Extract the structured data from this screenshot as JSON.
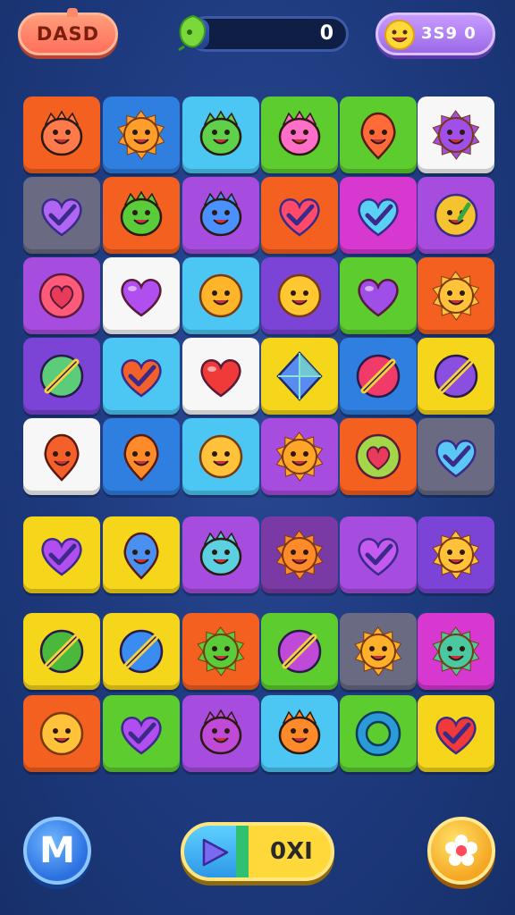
{
  "header": {
    "level_label": "DASD",
    "progress_value": "0",
    "progress_fraction": 0.0,
    "score_value": "3S9 0"
  },
  "footer": {
    "menu_label": "M",
    "play_label": "0XI"
  },
  "colors": {
    "orange": "#f4601f",
    "blue": "#2f7fe0",
    "cyan": "#4cc6f2",
    "green": "#5ccc2e",
    "white": "#f7f7f7",
    "gray": "#6a6a82",
    "purple": "#a64ddf",
    "violet": "#7b43d6",
    "magenta": "#d638d0",
    "yellow": "#f6d61a",
    "dark_purple": "#7a3aa6"
  },
  "board": {
    "rows": [
      [
        {
          "bg": "orange",
          "icon": "monster-icon",
          "ic": "#ff7a4a"
        },
        {
          "bg": "blue",
          "icon": "sun-icon",
          "ic": "#ff9e2a"
        },
        {
          "bg": "cyan",
          "icon": "monster-icon",
          "ic": "#5fd04a"
        },
        {
          "bg": "green",
          "icon": "monster-icon",
          "ic": "#ff6fc8"
        },
        {
          "bg": "green",
          "icon": "drop-face-icon",
          "ic": "#ff6a3a"
        },
        {
          "bg": "white",
          "icon": "sun-icon",
          "ic": "#a050e8"
        }
      ],
      [
        {
          "bg": "gray",
          "icon": "heart-check-icon",
          "ic": "#b066f2"
        },
        {
          "bg": "orange",
          "icon": "monster-icon",
          "ic": "#5acc3a"
        },
        {
          "bg": "purple",
          "icon": "monster-icon",
          "ic": "#4a90ff"
        },
        {
          "bg": "orange",
          "icon": "heart-check-icon",
          "ic": "#ff4a6a"
        },
        {
          "bg": "magenta",
          "icon": "heart-check-icon",
          "ic": "#5ad0f5"
        },
        {
          "bg": "purple",
          "icon": "face-check-icon",
          "ic": "#f5c330"
        }
      ],
      [
        {
          "bg": "purple",
          "icon": "heart-ring-icon",
          "ic": "#ff5a7a"
        },
        {
          "bg": "white",
          "icon": "heart-icon",
          "ic": "#b04ef0"
        },
        {
          "bg": "cyan",
          "icon": "smiley-icon",
          "ic": "#ffb52a"
        },
        {
          "bg": "violet",
          "icon": "smiley-icon",
          "ic": "#ffc830"
        },
        {
          "bg": "green",
          "icon": "heart-icon",
          "ic": "#a04ee8"
        },
        {
          "bg": "orange",
          "icon": "sun-icon",
          "ic": "#ffc23a"
        }
      ],
      [
        {
          "bg": "violet",
          "icon": "slash-ball-icon",
          "ic": "#5acc7a"
        },
        {
          "bg": "cyan",
          "icon": "heart-check-icon",
          "ic": "#f4602a"
        },
        {
          "bg": "white",
          "icon": "heart-icon",
          "ic": "#f03a3a"
        },
        {
          "bg": "yellow",
          "icon": "gem-icon",
          "ic": "#5a8cf0"
        },
        {
          "bg": "blue",
          "icon": "slash-ball-icon",
          "ic": "#f03a6a"
        },
        {
          "bg": "yellow",
          "icon": "slash-ball-icon",
          "ic": "#8a4ee0"
        }
      ],
      [
        {
          "bg": "white",
          "icon": "drop-face-icon",
          "ic": "#f4602a"
        },
        {
          "bg": "blue",
          "icon": "drop-face-icon",
          "ic": "#ff8a2a"
        },
        {
          "bg": "cyan",
          "icon": "smiley-icon",
          "ic": "#ffc23a"
        },
        {
          "bg": "purple",
          "icon": "sun-icon",
          "ic": "#ffa52a"
        },
        {
          "bg": "orange",
          "icon": "heart-ring-icon",
          "ic": "#a4d64a"
        },
        {
          "bg": "gray",
          "icon": "heart-check-icon",
          "ic": "#5ac8f5"
        }
      ],
      [
        {
          "bg": "yellow",
          "icon": "heart-check-icon",
          "ic": "#b04ef0"
        },
        {
          "bg": "yellow",
          "icon": "drop-face-icon",
          "ic": "#4a90f0"
        },
        {
          "bg": "purple",
          "icon": "monster-icon",
          "ic": "#5ad0e0"
        },
        {
          "bg": "dark_purple",
          "icon": "sun-icon",
          "ic": "#ff8a2a"
        },
        {
          "bg": "purple",
          "icon": "heart-check-icon",
          "ic": "#c45af0"
        },
        {
          "bg": "violet",
          "icon": "sun-icon",
          "ic": "#ffc23a"
        }
      ],
      [
        {
          "bg": "yellow",
          "icon": "slash-ball-icon",
          "ic": "#4ab83a"
        },
        {
          "bg": "yellow",
          "icon": "slash-ball-icon",
          "ic": "#3a8cf0"
        },
        {
          "bg": "orange",
          "icon": "sun-icon",
          "ic": "#5acc3a"
        },
        {
          "bg": "green",
          "icon": "slash-ball-icon",
          "ic": "#c04ad8"
        },
        {
          "bg": "gray",
          "icon": "sun-icon",
          "ic": "#ffb02a"
        },
        {
          "bg": "magenta",
          "icon": "sun-icon",
          "ic": "#4ac8a0"
        }
      ],
      [
        {
          "bg": "orange",
          "icon": "smiley-icon",
          "ic": "#ffc23a"
        },
        {
          "bg": "green",
          "icon": "heart-check-icon",
          "ic": "#b04ef0"
        },
        {
          "bg": "purple",
          "icon": "monster-icon",
          "ic": "#c04ad8"
        },
        {
          "bg": "cyan",
          "icon": "monster-icon",
          "ic": "#ff8a2a"
        },
        {
          "bg": "green",
          "icon": "ring-icon",
          "ic": "#2a9ad8"
        },
        {
          "bg": "yellow",
          "icon": "heart-check-icon",
          "ic": "#f03a3a"
        }
      ]
    ]
  }
}
